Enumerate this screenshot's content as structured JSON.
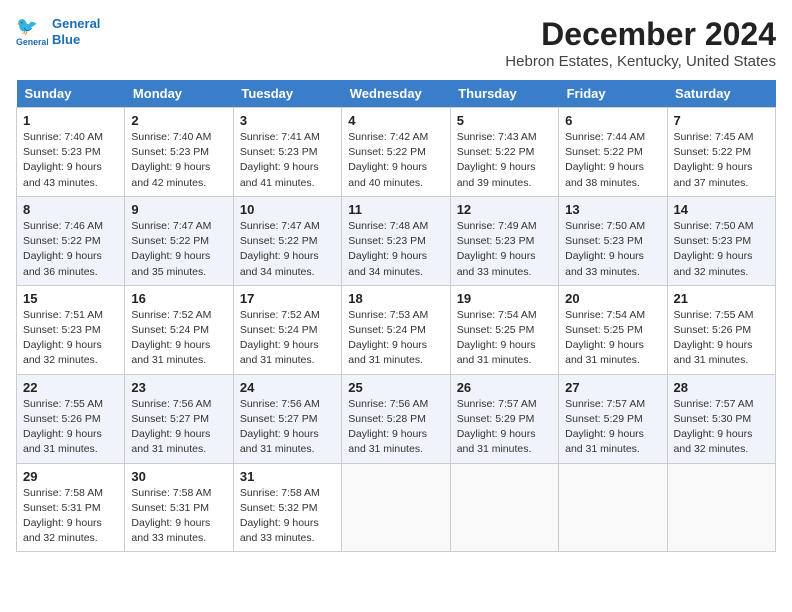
{
  "header": {
    "logo_line1": "General",
    "logo_line2": "Blue",
    "main_title": "December 2024",
    "subtitle": "Hebron Estates, Kentucky, United States"
  },
  "calendar": {
    "columns": [
      "Sunday",
      "Monday",
      "Tuesday",
      "Wednesday",
      "Thursday",
      "Friday",
      "Saturday"
    ],
    "weeks": [
      [
        {
          "day": "1",
          "sunrise": "Sunrise: 7:40 AM",
          "sunset": "Sunset: 5:23 PM",
          "daylight": "Daylight: 9 hours and 43 minutes."
        },
        {
          "day": "2",
          "sunrise": "Sunrise: 7:40 AM",
          "sunset": "Sunset: 5:23 PM",
          "daylight": "Daylight: 9 hours and 42 minutes."
        },
        {
          "day": "3",
          "sunrise": "Sunrise: 7:41 AM",
          "sunset": "Sunset: 5:23 PM",
          "daylight": "Daylight: 9 hours and 41 minutes."
        },
        {
          "day": "4",
          "sunrise": "Sunrise: 7:42 AM",
          "sunset": "Sunset: 5:22 PM",
          "daylight": "Daylight: 9 hours and 40 minutes."
        },
        {
          "day": "5",
          "sunrise": "Sunrise: 7:43 AM",
          "sunset": "Sunset: 5:22 PM",
          "daylight": "Daylight: 9 hours and 39 minutes."
        },
        {
          "day": "6",
          "sunrise": "Sunrise: 7:44 AM",
          "sunset": "Sunset: 5:22 PM",
          "daylight": "Daylight: 9 hours and 38 minutes."
        },
        {
          "day": "7",
          "sunrise": "Sunrise: 7:45 AM",
          "sunset": "Sunset: 5:22 PM",
          "daylight": "Daylight: 9 hours and 37 minutes."
        }
      ],
      [
        {
          "day": "8",
          "sunrise": "Sunrise: 7:46 AM",
          "sunset": "Sunset: 5:22 PM",
          "daylight": "Daylight: 9 hours and 36 minutes."
        },
        {
          "day": "9",
          "sunrise": "Sunrise: 7:47 AM",
          "sunset": "Sunset: 5:22 PM",
          "daylight": "Daylight: 9 hours and 35 minutes."
        },
        {
          "day": "10",
          "sunrise": "Sunrise: 7:47 AM",
          "sunset": "Sunset: 5:22 PM",
          "daylight": "Daylight: 9 hours and 34 minutes."
        },
        {
          "day": "11",
          "sunrise": "Sunrise: 7:48 AM",
          "sunset": "Sunset: 5:23 PM",
          "daylight": "Daylight: 9 hours and 34 minutes."
        },
        {
          "day": "12",
          "sunrise": "Sunrise: 7:49 AM",
          "sunset": "Sunset: 5:23 PM",
          "daylight": "Daylight: 9 hours and 33 minutes."
        },
        {
          "day": "13",
          "sunrise": "Sunrise: 7:50 AM",
          "sunset": "Sunset: 5:23 PM",
          "daylight": "Daylight: 9 hours and 33 minutes."
        },
        {
          "day": "14",
          "sunrise": "Sunrise: 7:50 AM",
          "sunset": "Sunset: 5:23 PM",
          "daylight": "Daylight: 9 hours and 32 minutes."
        }
      ],
      [
        {
          "day": "15",
          "sunrise": "Sunrise: 7:51 AM",
          "sunset": "Sunset: 5:23 PM",
          "daylight": "Daylight: 9 hours and 32 minutes."
        },
        {
          "day": "16",
          "sunrise": "Sunrise: 7:52 AM",
          "sunset": "Sunset: 5:24 PM",
          "daylight": "Daylight: 9 hours and 31 minutes."
        },
        {
          "day": "17",
          "sunrise": "Sunrise: 7:52 AM",
          "sunset": "Sunset: 5:24 PM",
          "daylight": "Daylight: 9 hours and 31 minutes."
        },
        {
          "day": "18",
          "sunrise": "Sunrise: 7:53 AM",
          "sunset": "Sunset: 5:24 PM",
          "daylight": "Daylight: 9 hours and 31 minutes."
        },
        {
          "day": "19",
          "sunrise": "Sunrise: 7:54 AM",
          "sunset": "Sunset: 5:25 PM",
          "daylight": "Daylight: 9 hours and 31 minutes."
        },
        {
          "day": "20",
          "sunrise": "Sunrise: 7:54 AM",
          "sunset": "Sunset: 5:25 PM",
          "daylight": "Daylight: 9 hours and 31 minutes."
        },
        {
          "day": "21",
          "sunrise": "Sunrise: 7:55 AM",
          "sunset": "Sunset: 5:26 PM",
          "daylight": "Daylight: 9 hours and 31 minutes."
        }
      ],
      [
        {
          "day": "22",
          "sunrise": "Sunrise: 7:55 AM",
          "sunset": "Sunset: 5:26 PM",
          "daylight": "Daylight: 9 hours and 31 minutes."
        },
        {
          "day": "23",
          "sunrise": "Sunrise: 7:56 AM",
          "sunset": "Sunset: 5:27 PM",
          "daylight": "Daylight: 9 hours and 31 minutes."
        },
        {
          "day": "24",
          "sunrise": "Sunrise: 7:56 AM",
          "sunset": "Sunset: 5:27 PM",
          "daylight": "Daylight: 9 hours and 31 minutes."
        },
        {
          "day": "25",
          "sunrise": "Sunrise: 7:56 AM",
          "sunset": "Sunset: 5:28 PM",
          "daylight": "Daylight: 9 hours and 31 minutes."
        },
        {
          "day": "26",
          "sunrise": "Sunrise: 7:57 AM",
          "sunset": "Sunset: 5:29 PM",
          "daylight": "Daylight: 9 hours and 31 minutes."
        },
        {
          "day": "27",
          "sunrise": "Sunrise: 7:57 AM",
          "sunset": "Sunset: 5:29 PM",
          "daylight": "Daylight: 9 hours and 31 minutes."
        },
        {
          "day": "28",
          "sunrise": "Sunrise: 7:57 AM",
          "sunset": "Sunset: 5:30 PM",
          "daylight": "Daylight: 9 hours and 32 minutes."
        }
      ],
      [
        {
          "day": "29",
          "sunrise": "Sunrise: 7:58 AM",
          "sunset": "Sunset: 5:31 PM",
          "daylight": "Daylight: 9 hours and 32 minutes."
        },
        {
          "day": "30",
          "sunrise": "Sunrise: 7:58 AM",
          "sunset": "Sunset: 5:31 PM",
          "daylight": "Daylight: 9 hours and 33 minutes."
        },
        {
          "day": "31",
          "sunrise": "Sunrise: 7:58 AM",
          "sunset": "Sunset: 5:32 PM",
          "daylight": "Daylight: 9 hours and 33 minutes."
        },
        null,
        null,
        null,
        null
      ]
    ]
  }
}
